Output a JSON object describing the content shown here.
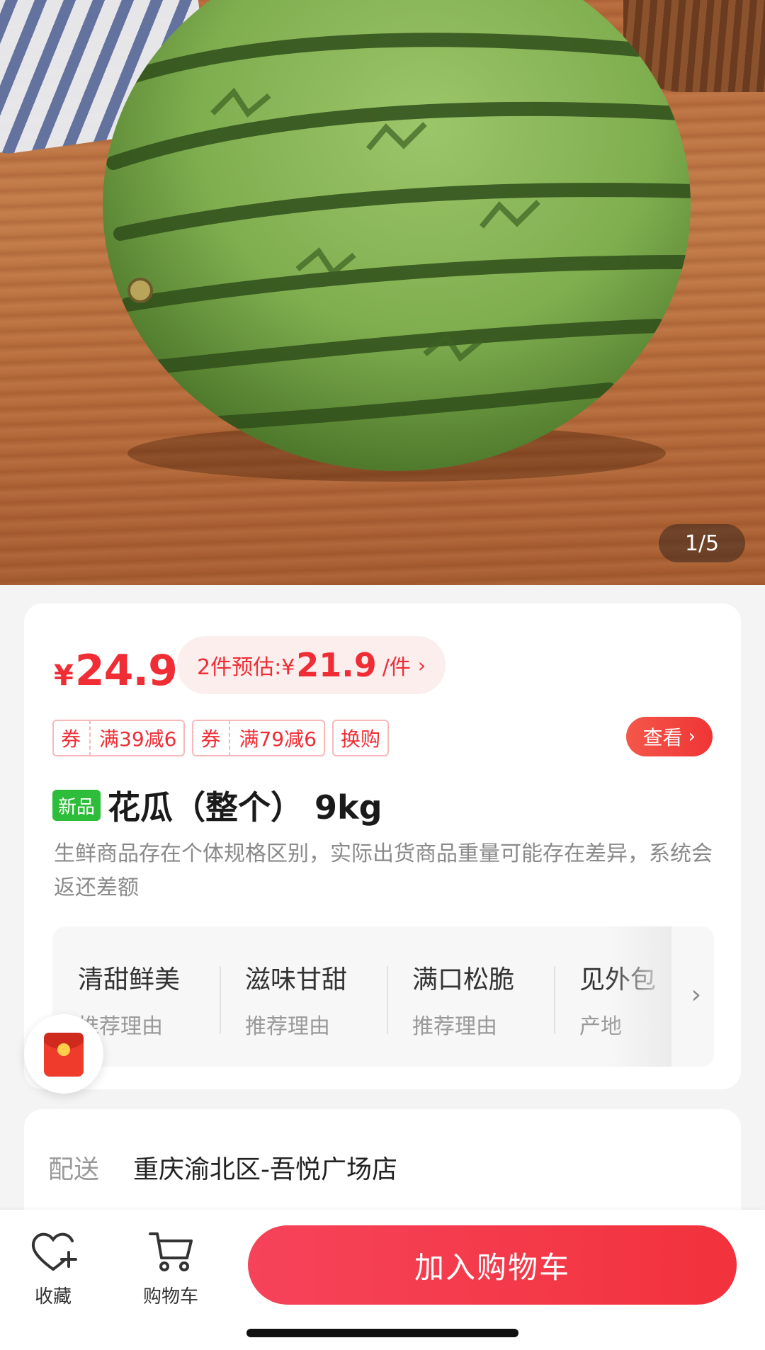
{
  "gallery": {
    "page_indicator": "1/5"
  },
  "product": {
    "price_symbol": "¥",
    "price": "24.9",
    "estimate": {
      "prefix": "2件预估:¥",
      "value": "21.9",
      "suffix": "/件",
      "chevron": "›"
    },
    "tags": [
      {
        "label": "券",
        "text": "满39减6"
      },
      {
        "label": "券",
        "text": "满79减6"
      },
      {
        "text": "换购"
      }
    ],
    "view_button": {
      "label": "查看",
      "chevron": "›"
    },
    "new_badge": "新品",
    "title": "花瓜（整个） 9kg",
    "description": "生鲜商品存在个体规格区别，实际出货商品重量可能存在差异，系统会返还差额",
    "reasons": [
      {
        "title": "清甜鲜美",
        "sub": "推荐理由"
      },
      {
        "title": "滋味甘甜",
        "sub": "推荐理由"
      },
      {
        "title": "满口松脆",
        "sub": "推荐理由"
      },
      {
        "title": "见外包",
        "sub": "产地"
      }
    ],
    "reasons_chevron": "›"
  },
  "delivery": {
    "label": "配送",
    "value": "重庆渝北区-吾悦广场店"
  },
  "bottom_bar": {
    "favorite_label": "收藏",
    "cart_label": "购物车",
    "add_to_cart": "加入购物车"
  },
  "icons": [
    "heart-plus-icon",
    "cart-icon",
    "red-packet-icon",
    "chevron-right-icon"
  ],
  "colors": {
    "accent_red": "#f02d35",
    "new_green": "#2dbd3a"
  }
}
